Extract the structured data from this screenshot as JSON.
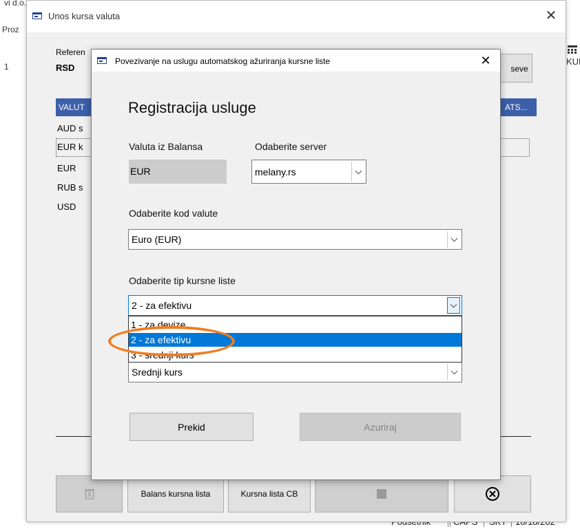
{
  "background": {
    "frag_top": "vi d.o.o.",
    "frag_proz": "Proz",
    "frag_one": "1",
    "frag_kul": "KUL",
    "status": {
      "podsetnik": "Podsetnik",
      "caps": "CAPS",
      "skt": "SKT",
      "date": "10/18/202"
    }
  },
  "outer_window": {
    "title": "Unos kursa valuta",
    "close": "✕",
    "referen_label": "Referen",
    "rsd": "RSD",
    "seve_button": "seve",
    "header": {
      "valut": "VALUT",
      "ats": "ATS..."
    },
    "rows": [
      "AUD s",
      "EUR k",
      "EUR",
      "RUB s",
      "USD"
    ],
    "bottom_buttons": {
      "balans": "Balans kursna lista",
      "cb": "Kursna lista CB"
    }
  },
  "dialog": {
    "title": "Povezivanje na uslugu automatskog ažuriranja kursne liste",
    "close": "✕",
    "heading": "Registracija usluge",
    "valuta_label": "Valuta iz Balansa",
    "valuta_value": "EUR",
    "server_label": "Odaberite server",
    "server_value": "melany.rs",
    "kod_label": "Odaberite kod valute",
    "kod_value": "Euro (EUR)",
    "tip_label": "Odaberite tip kursne liste",
    "tip_value": "2 - za efektivu",
    "tip_options": [
      "1 - za devize",
      "2 - za efektivu",
      "3 - srednji kurs"
    ],
    "tip_selected_index": 1,
    "hidden_value": "Srednji kurs",
    "prekid_button": "Prekid",
    "azuriraj_button": "Azuriraj"
  },
  "colors": {
    "accent": "#0078d7",
    "highlight": "#f07d22",
    "header": "#3c5faa"
  }
}
